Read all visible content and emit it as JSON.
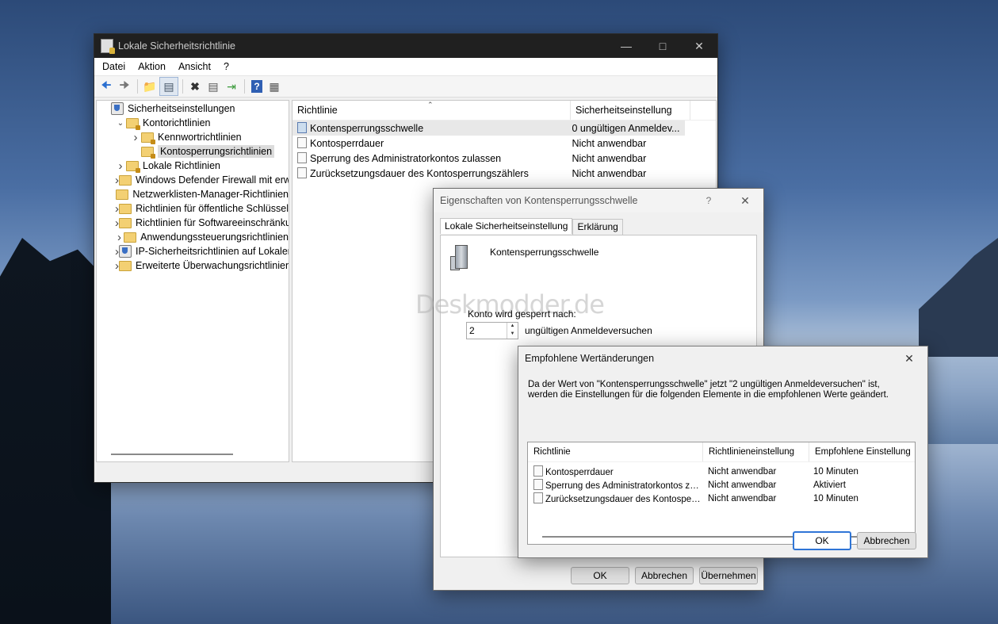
{
  "main": {
    "title": "Lokale Sicherheitsrichtlinie",
    "menu": [
      "Datei",
      "Aktion",
      "Ansicht",
      "?"
    ],
    "tree": [
      {
        "label": "Sicherheitseinstellungen",
        "indent": 0,
        "twisty": "",
        "icon": "shield"
      },
      {
        "label": "Kontorichtlinien",
        "indent": 1,
        "twisty": "v",
        "icon": "folder-lock"
      },
      {
        "label": "Kennwortrichtlinien",
        "indent": 2,
        "twisty": ">",
        "icon": "folder-lock"
      },
      {
        "label": "Kontosperrungsrichtlinien",
        "indent": 2,
        "twisty": "",
        "icon": "folder-lock",
        "selected": true
      },
      {
        "label": "Lokale Richtlinien",
        "indent": 1,
        "twisty": ">",
        "icon": "folder-lock"
      },
      {
        "label": "Windows Defender Firewall mit erweit",
        "indent": 1,
        "twisty": ">",
        "icon": "folder"
      },
      {
        "label": "Netzwerklisten-Manager-Richtlinien",
        "indent": 1,
        "twisty": "",
        "icon": "folder"
      },
      {
        "label": "Richtlinien für öffentliche Schlüssel",
        "indent": 1,
        "twisty": ">",
        "icon": "folder"
      },
      {
        "label": "Richtlinien für Softwareeinschränkung",
        "indent": 1,
        "twisty": ">",
        "icon": "folder"
      },
      {
        "label": "Anwendungssteuerungsrichtlinien",
        "indent": 1,
        "twisty": ">",
        "icon": "folder"
      },
      {
        "label": "IP-Sicherheitsrichtlinien auf Lokaler C",
        "indent": 1,
        "twisty": ">",
        "icon": "shield"
      },
      {
        "label": "Erweiterte Überwachungsrichtlinienkc",
        "indent": 1,
        "twisty": ">",
        "icon": "folder"
      }
    ],
    "list_headers": [
      "Richtlinie",
      "Sicherheitseinstellung"
    ],
    "list_rows": [
      {
        "policy": "Kontensperrungsschwelle",
        "setting": "0 ungültigen Anmeldev...",
        "selected": true
      },
      {
        "policy": "Kontosperrdauer",
        "setting": "Nicht anwendbar"
      },
      {
        "policy": "Sperrung des Administratorkontos zulassen",
        "setting": "Nicht anwendbar"
      },
      {
        "policy": "Zurücksetzungsdauer des Kontosperrungszählers",
        "setting": "Nicht anwendbar"
      }
    ]
  },
  "props": {
    "title": "Eigenschaften von Kontensperrungsschwelle",
    "help": "?",
    "tabs": [
      "Lokale Sicherheitseinstellung",
      "Erklärung"
    ],
    "heading": "Kontensperrungsschwelle",
    "lockout_label": "Konto wird gesperrt nach:",
    "lockout_value": "2",
    "lockout_suffix": "ungültigen Anmeldeversuchen",
    "watermark": "Deskmodder.de",
    "buttons": {
      "ok": "OK",
      "cancel": "Abbrechen",
      "apply": "Übernehmen"
    }
  },
  "rec": {
    "title": "Empfohlene Wertänderungen",
    "message": "Da der Wert von \"Kontensperrungsschwelle\" jetzt \"2 ungültigen Anmeldeversuchen\" ist, werden die Einstellungen für die folgenden Elemente in die empfohlenen Werte geändert.",
    "headers": [
      "Richtlinie",
      "Richtlinieneinstellung",
      "Empfohlene Einstellung"
    ],
    "rows": [
      {
        "policy": "Kontosperrdauer",
        "current": "Nicht anwendbar",
        "recommended": "10 Minuten"
      },
      {
        "policy": "Sperrung des Administratorkontos zulas...",
        "current": "Nicht anwendbar",
        "recommended": "Aktiviert"
      },
      {
        "policy": "Zurücksetzungsdauer des Kontosperru...",
        "current": "Nicht anwendbar",
        "recommended": "10 Minuten"
      }
    ],
    "buttons": {
      "ok": "OK",
      "cancel": "Abbrechen"
    }
  },
  "colors": {
    "accent": "#2f75d6",
    "titlebar_dark": "#202020"
  }
}
